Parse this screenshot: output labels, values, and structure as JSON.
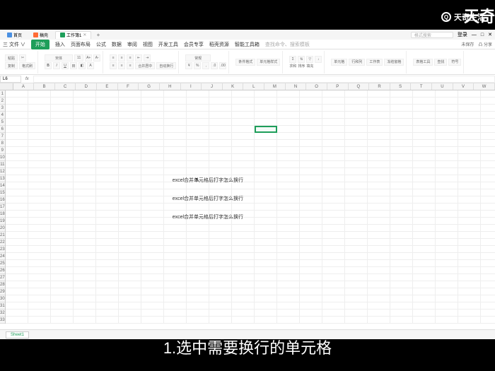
{
  "brand": {
    "logo": "Q",
    "name": "天奇生活",
    "big": "天奇"
  },
  "caption": "1.选中需要换行的单元格",
  "tabs": {
    "home": "首页",
    "word_doc": "稿壳",
    "sheet_doc": "工作簿1",
    "plus": "+"
  },
  "search": {
    "placeholder": "格式搜索"
  },
  "title_right": {
    "login": "登录",
    "min": "—",
    "max": "□",
    "close": "✕"
  },
  "menu": {
    "file": "三 文件 ∨",
    "items": [
      "开始",
      "插入",
      "页面布局",
      "公式",
      "数据",
      "审阅",
      "视图",
      "开发工具",
      "会员专享",
      "稻壳资源",
      "智能工具箱"
    ],
    "search_hint": "查找命令、搜索模板",
    "right": [
      "未保存",
      "凸 分享"
    ]
  },
  "ribbon": {
    "paste": "粘贴",
    "cut": "剪切",
    "copy": "复制",
    "format_painter": "格式刷",
    "font": "宋体",
    "size": "11",
    "merge": "合并居中",
    "wrap": "自动换行",
    "general": "常规",
    "cond_format": "条件格式",
    "cell_style": "单元格样式",
    "sum": "求和",
    "sort_filter": "排序",
    "fill": "填充",
    "cell": "单元格",
    "row_col": "行和列",
    "worksheet": "工作表",
    "freeze": "冻结窗格",
    "table_tools": "表格工具",
    "find": "查找",
    "symbol": "符号"
  },
  "formula_bar": {
    "name_box": "L6",
    "fx": "fx"
  },
  "columns": [
    "A",
    "B",
    "C",
    "D",
    "E",
    "F",
    "G",
    "H",
    "I",
    "J",
    "K",
    "L",
    "M",
    "N",
    "O",
    "P",
    "Q",
    "R",
    "S",
    "T",
    "U",
    "V",
    "W"
  ],
  "active_cell": {
    "col": 11,
    "row": 5,
    "colspan": 1,
    "rowspan": 1
  },
  "cell_content": {
    "r1": "excel合并单元格后打字怎么换行",
    "r2": "excel合并单元格后打字怎么换行",
    "r3": "excel合并单元格后打字怎么换行"
  },
  "sheet": {
    "tab1": "Sheet1"
  }
}
